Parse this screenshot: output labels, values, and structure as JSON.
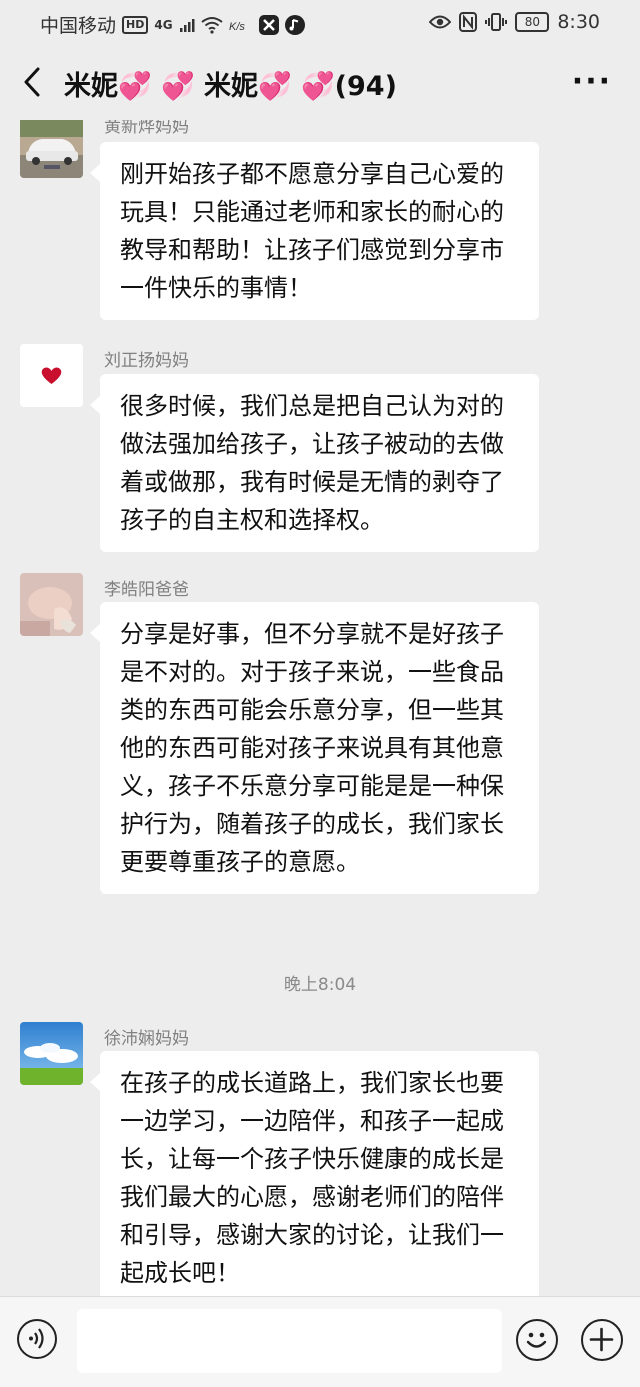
{
  "status_bar": {
    "carrier": "中国移动",
    "hd_badge": "HD",
    "network": "4G",
    "battery": "80",
    "time": "8:30"
  },
  "header": {
    "back_icon": "chevron-left-icon",
    "title": "米妮💞 💞 米妮💞 💞(94)",
    "more_icon": "more-dots-icon",
    "more_label": "···"
  },
  "messages": [
    {
      "sender": "黄新烨妈妈",
      "avatar": "car-photo",
      "text": "刚开始孩子都不愿意分享自己心爱的玩具！只能通过老师和家长的耐心的教导和帮助！让孩子们感觉到分享市一件快乐的事情！"
    },
    {
      "sender": "刘正扬妈妈",
      "avatar": "heart-photo",
      "text": "很多时候，我们总是把自己认为对的做法强加给孩子，让孩子被动的去做着或做那，我有时候是无情的剥夺了孩子的自主权和选择权。"
    },
    {
      "sender": "李皓阳爸爸",
      "avatar": "hand-photo",
      "text": "分享是好事，但不分享就不是好孩子是不对的。对于孩子来说，一些食品类的东西可能会乐意分享，但一些其他的东西可能对孩子来说具有其他意义，孩子不乐意分享可能是是一种保护行为，随着孩子的成长，我们家长更要尊重孩子的意愿。"
    },
    {
      "sender": "徐沛娴妈妈",
      "avatar": "sky-photo",
      "text": "在孩子的成长道路上，我们家长也要一边学习，一边陪伴，和孩子一起成长，让每一个孩子快乐健康的成长是我们最大的心愿，感谢老师们的陪伴和引导，感谢大家的讨论，让我们一起成长吧！"
    }
  ],
  "timestamp": "晚上8:04",
  "input_bar": {
    "voice_icon": "voice-icon",
    "emoji_icon": "emoji-icon",
    "plus_icon": "plus-icon"
  }
}
